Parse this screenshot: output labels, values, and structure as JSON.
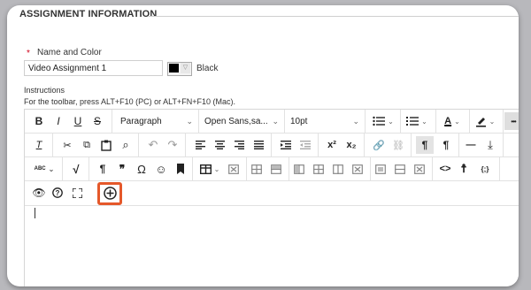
{
  "section": {
    "title": "ASSIGNMENT INFORMATION"
  },
  "name_field": {
    "required_marker": "*",
    "label": "Name and Color",
    "value": "Video Assignment 1"
  },
  "color_picker": {
    "swatch": "#000000",
    "caret": "▽",
    "name": "Black"
  },
  "instructions": {
    "label": "Instructions",
    "toolbar_hint": "For the toolbar, press ALT+F10 (PC) or ALT+FN+F10 (Mac)."
  },
  "toolbar": {
    "bold": "B",
    "italic": "I",
    "underline": "U",
    "strikethrough": "S",
    "paragraph_format": "Paragraph",
    "font_family": "Open Sans,sa...",
    "font_size": "10pt",
    "more": "•••",
    "clear_format": "T",
    "cut": "✂",
    "copy": "⧉",
    "paste": "📋",
    "find": "⌕",
    "undo": "↶",
    "redo": "↷",
    "superscript": "x²",
    "subscript": "x₂",
    "link": "🔗",
    "unlink": "⛓",
    "ltr": "¶",
    "rtl": "¶",
    "hr": "—",
    "upload": "⤓",
    "spellcheck": "ABC",
    "math": "√",
    "pilcrow": "¶",
    "quote": "❞",
    "omega": "Ω",
    "emoji": "☺",
    "bookmark": "▮",
    "code": "<>",
    "accessibility": "☨",
    "source": "{;}",
    "preview": "👁",
    "help": "?",
    "fullscreen": "⛶",
    "add_content": "⊕"
  },
  "accent": "#e5582a"
}
